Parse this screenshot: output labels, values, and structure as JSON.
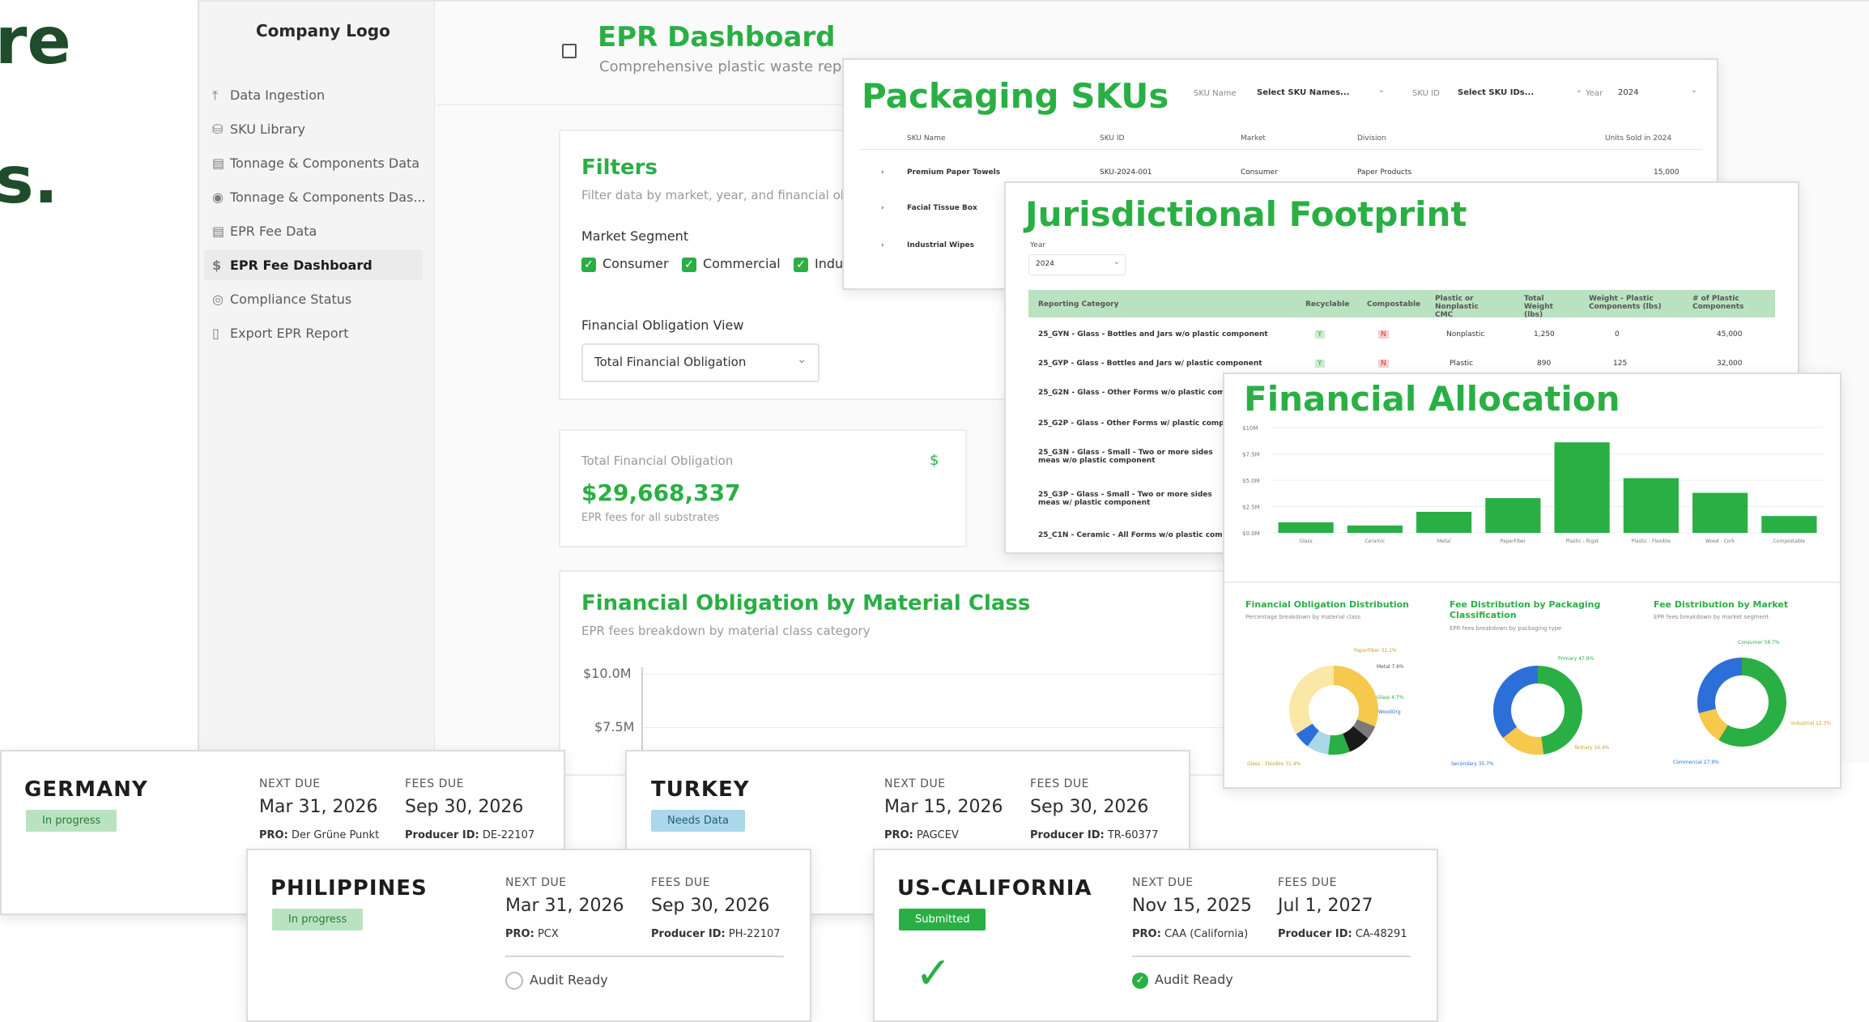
{
  "hero": {
    "line1": "re",
    "line2": "s."
  },
  "sidebar": {
    "logo": "Company Logo",
    "items": [
      {
        "icon": "upload-icon",
        "label": "Data Ingestion"
      },
      {
        "icon": "database-icon",
        "label": "SKU Library"
      },
      {
        "icon": "table-icon",
        "label": "Tonnage & Components Data"
      },
      {
        "icon": "chart-icon",
        "label": "Tonnage & Components Das..."
      },
      {
        "icon": "table-icon",
        "label": "EPR Fee Data"
      },
      {
        "icon": "dollar-icon",
        "label": "EPR Fee Dashboard"
      },
      {
        "icon": "check-circle-icon",
        "label": "Compliance Status"
      },
      {
        "icon": "file-icon",
        "label": "Export EPR Report"
      }
    ]
  },
  "dashboard": {
    "title": "EPR Dashboard",
    "subtitle": "Comprehensive plastic waste rep",
    "filters": {
      "title": "Filters",
      "subtitle": "Filter data by market, year, and financial ob",
      "market_label": "Market Segment",
      "opt_consumer": "Consumer",
      "opt_commercial": "Commercial",
      "opt_industrial": "Indu",
      "view_label": "Financial Obligation View",
      "view_value": "Total Financial Obligation"
    },
    "total": {
      "label": "Total Financial Obligation",
      "value": "$29,668,337",
      "note": "EPR fees for all substrates",
      "currency": "$"
    },
    "material": {
      "title": "Financial Obligation by Material Class",
      "subtitle": "EPR fees breakdown by material class category",
      "ticks": [
        "$10.0M",
        "$7.5M"
      ]
    }
  },
  "skus": {
    "title": "Packaging SKUs",
    "filter_name_label": "SKU Name",
    "filter_name_value": "Select SKU Names...",
    "filter_id_label": "SKU ID",
    "filter_id_value": "Select SKU IDs...",
    "filter_year_label": "Year",
    "filter_year_value": "2024",
    "headers": [
      "SKU Name",
      "SKU ID",
      "Market",
      "Division",
      "Units Sold in 2024"
    ],
    "rows": [
      {
        "name": "Premium Paper Towels",
        "id": "SKU-2024-001",
        "market": "Consumer",
        "division": "Paper Products",
        "units": "15,000"
      },
      {
        "name": "Facial Tissue Box",
        "id": "",
        "market": "",
        "division": "",
        "units": ""
      },
      {
        "name": "Industrial Wipes",
        "id": "",
        "market": "",
        "division": "",
        "units": ""
      }
    ]
  },
  "jurisdiction": {
    "title": "Jurisdictional Footprint",
    "year_label": "Year",
    "year_value": "2024",
    "headers": [
      "Reporting Category",
      "Recyclable",
      "Compostable",
      "Plastic or Nonplastic CMC",
      "Total Weight (lbs)",
      "Weight - Plastic Components (lbs)",
      "# of Plastic Components"
    ],
    "rows": [
      {
        "cat": "25_GYN - Glass - Bottles and Jars w/o plastic component",
        "rec": "Y",
        "comp": "N",
        "type": "Nonplastic",
        "weight": "1,250",
        "pw": "0",
        "n": "45,000"
      },
      {
        "cat": "25_GYP - Glass - Bottles and Jars w/ plastic component",
        "rec": "Y",
        "comp": "N",
        "type": "Plastic",
        "weight": "890",
        "pw": "125",
        "n": "32,000"
      },
      {
        "cat": "25_G2N - Glass - Other Forms w/o plastic compo"
      },
      {
        "cat": "25_G2P - Glass - Other Forms w/ plastic compone"
      },
      {
        "cat": "25_G3N - Glass - Small - Two or more sides meas w/o plastic component"
      },
      {
        "cat": "25_G3P - Glass - Small - Two or more sides meas w/ plastic component"
      },
      {
        "cat": "25_C1N - Ceramic - All Forms w/o plastic compo"
      }
    ]
  },
  "allocation": {
    "title": "Financial Allocation",
    "y_ticks": [
      "$10M",
      "$7.5M",
      "$5.0M",
      "$2.5M",
      "$0.0M"
    ],
    "donuts": [
      {
        "title": "Financial Obligation Distribution",
        "subtitle": "Percentage breakdown by material class",
        "labels": [
          "PaperFiber 31.1%",
          "Metal 7.6%",
          "Glass 4.7%",
          "WoodOrg",
          "Glass - Flexible 31.4%"
        ]
      },
      {
        "title": "Fee Distribution by Packaging Classification",
        "subtitle": "EPR fees breakdown by packaging type",
        "labels": [
          "Primary 47.9%",
          "Secondary 35.7%",
          "Tertiary 16.4%"
        ]
      },
      {
        "title": "Fee Distribution by Market",
        "subtitle": "EPR fees breakdown by market segment",
        "labels": [
          "Consumer 58.7%",
          "Industrial 12.3%",
          "Commercial 27.9%"
        ]
      }
    ]
  },
  "chart_data": {
    "type": "bar",
    "title": "Financial Allocation",
    "ylim": [
      0,
      10
    ],
    "categories": [
      "Glass",
      "Ceramic",
      "Metal",
      "PaperFiber",
      "Plastic - Rigid",
      "Plastic - Flexible",
      "Wood - Cork",
      "Compostable"
    ],
    "values": [
      1.0,
      0.7,
      2.0,
      3.3,
      8.6,
      5.2,
      3.8,
      1.6
    ],
    "color": "#2aaf44"
  },
  "markets": [
    {
      "country": "GERMANY",
      "status": "In progress",
      "status_type": "progress",
      "next_due_label": "NEXT DUE",
      "next_due": "Mar 31, 2026",
      "fees_due_label": "FEES DUE",
      "fees_due": "Sep 30, 2026",
      "pro_label": "PRO:",
      "pro": "Der Grüne Punkt",
      "producer_label": "Producer ID:",
      "producer": "DE-22107"
    },
    {
      "country": "TURKEY",
      "status": "Needs Data",
      "status_type": "needs",
      "next_due_label": "NEXT DUE",
      "next_due": "Mar 15, 2026",
      "fees_due_label": "FEES DUE",
      "fees_due": "Sep 30, 2026",
      "pro_label": "PRO:",
      "pro": "PAGCEV",
      "producer_label": "Producer ID:",
      "producer": "TR-60377"
    },
    {
      "country": "PHILIPPINES",
      "status": "In progress",
      "status_type": "progress",
      "next_due_label": "NEXT DUE",
      "next_due": "Mar 31, 2026",
      "fees_due_label": "FEES DUE",
      "fees_due": "Sep 30, 2026",
      "pro_label": "PRO:",
      "pro": "PCX",
      "producer_label": "Producer ID:",
      "producer": "PH-22107",
      "audit": "Audit Ready",
      "audit_done": false
    },
    {
      "country": "US-CALIFORNIA",
      "status": "Submitted",
      "status_type": "submitted",
      "next_due_label": "NEXT DUE",
      "next_due": "Nov 15, 2025",
      "fees_due_label": "FEES DUE",
      "fees_due": "Jul 1, 2027",
      "pro_label": "PRO:",
      "pro": "CAA (California)",
      "producer_label": "Producer ID:",
      "producer": "CA-48291",
      "audit": "Audit Ready",
      "audit_done": true
    }
  ],
  "colors": {
    "accent": "#2aaf44",
    "dark_green": "#1f4d2c",
    "needs_data": "#a8d8ea",
    "in_progress": "#b9e3c0"
  }
}
